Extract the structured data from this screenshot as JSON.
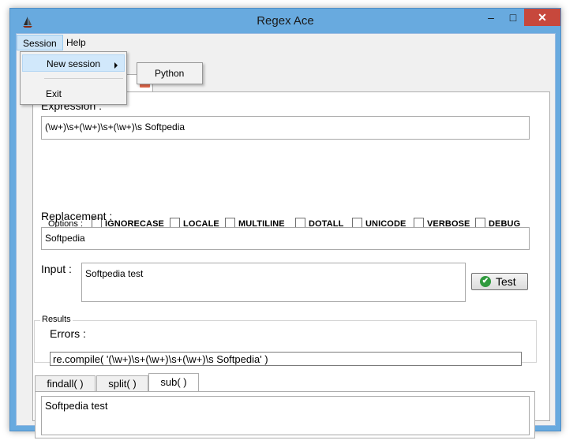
{
  "window": {
    "title": "Regex Ace",
    "minimize_glyph": "–",
    "maximize_glyph": "□",
    "close_glyph": "✕"
  },
  "menu": {
    "session": "Session",
    "help": "Help"
  },
  "session_menu": {
    "new_session": "New session",
    "exit": "Exit"
  },
  "new_session_submenu": {
    "python": "Python"
  },
  "session_tab": {
    "label": "n",
    "close_glyph": "✕"
  },
  "expression": {
    "label": "Expression :",
    "value": "(\\w+)\\s+(\\w+)\\s+(\\w+)\\s Softpedia"
  },
  "options": {
    "label": "Options :",
    "flags": [
      {
        "label": "IGNORECASE",
        "checked": false
      },
      {
        "label": "LOCALE",
        "checked": false
      },
      {
        "label": "MULTILINE",
        "checked": false
      },
      {
        "label": "DOTALL",
        "checked": false
      },
      {
        "label": "UNICODE",
        "checked": false
      },
      {
        "label": "VERBOSE",
        "checked": false
      },
      {
        "label": "DEBUG",
        "checked": false
      }
    ]
  },
  "replacement": {
    "label": "Replacement :",
    "value": "Softpedia"
  },
  "input": {
    "label": "Input :",
    "value": "Softpedia test"
  },
  "test_button": {
    "label": "Test",
    "icon_glyph": "✔"
  },
  "results": {
    "title": "Results",
    "errors_label": "Errors :",
    "compile_text": "re.compile( '(\\w+)\\s+(\\w+)\\s+(\\w+)\\s Softpedia' )",
    "tabs": [
      {
        "label": "findall( )",
        "active": false
      },
      {
        "label": "split( )",
        "active": false
      },
      {
        "label": "sub( )",
        "active": true
      }
    ],
    "output": "Softpedia test"
  },
  "colors": {
    "titlebar": "#68aadf",
    "close_button": "#c7483c",
    "menu_highlight": "#cce4f7",
    "test_icon": "#2f9a3e",
    "tab_close": "#e86c4f"
  }
}
